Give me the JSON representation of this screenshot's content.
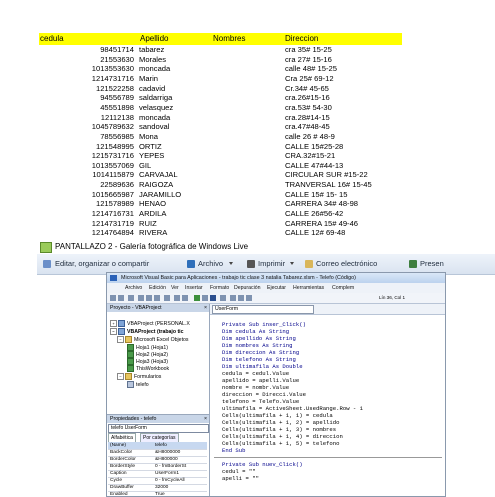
{
  "spreadsheet": {
    "headers": {
      "cedula": "cedula",
      "apellido": "Apellido",
      "nombres": "Nombres",
      "direccion": "Direccion"
    },
    "rows": [
      {
        "cedula": "98451714",
        "apellido": "tabarez",
        "direccion": "cra 35# 15-25"
      },
      {
        "cedula": "21553630",
        "apellido": "Morales",
        "direccion": "cra 27# 15-16"
      },
      {
        "cedula": "1013553630",
        "apellido": "moncada",
        "direccion": "calle 48# 15-25"
      },
      {
        "cedula": "1214731716",
        "apellido": "Marin",
        "direccion": "Cra 25# 69-12"
      },
      {
        "cedula": "121522258",
        "apellido": "cadavid",
        "direccion": "Cr.34# 45-65"
      },
      {
        "cedula": "94556789",
        "apellido": "saldarriga",
        "direccion": "cra.26#15-16"
      },
      {
        "cedula": "45551898",
        "apellido": "velasquez",
        "direccion": "cra.53# 54-30"
      },
      {
        "cedula": "12112138",
        "apellido": "moncada",
        "direccion": "cra.28#14-15"
      },
      {
        "cedula": "1045789632",
        "apellido": "sandoval",
        "direccion": "cra.47#48-45"
      },
      {
        "cedula": "78556985",
        "apellido": "Mona",
        "direccion": "calle 26 # 48-9"
      },
      {
        "cedula": "121548995",
        "apellido": "ORTIZ",
        "direccion": "CALLE 15#25-28"
      },
      {
        "cedula": "1215731716",
        "apellido": "YEPES",
        "direccion": "CRA.32#15-21"
      },
      {
        "cedula": "1013557069",
        "apellido": "GIL",
        "direccion": "CALLE 47#44-13"
      },
      {
        "cedula": "1014115879",
        "apellido": "CARVAJAL",
        "direccion": "CIRCULAR SUR #15-22"
      },
      {
        "cedula": "22589636",
        "apellido": "RAIGOZA",
        "direccion": "TRANVERSAL 16# 15-45"
      },
      {
        "cedula": "1015665987",
        "apellido": "JARAMILLO",
        "direccion": "CALLE 15# 15- 15"
      },
      {
        "cedula": "121578989",
        "apellido": "HENAO",
        "direccion": "CARRERA 34# 48-98"
      },
      {
        "cedula": "1214716731",
        "apellido": "ARDILA",
        "direccion": "CALLE 26#56-42"
      },
      {
        "cedula": "1214731719",
        "apellido": "RUIZ",
        "direccion": "CARRERA 15# 49-46"
      },
      {
        "cedula": "1214764894",
        "apellido": "RIVERA",
        "direccion": "CALLE 12# 69-48"
      }
    ]
  },
  "gallery": {
    "title": "PANTALLAZO 2 - Galería fotográfica de Windows Live",
    "toolbar": {
      "edit_share": "Editar, organizar o compartir",
      "file": "Archivo",
      "print": "Imprimir",
      "email": "Correo electrónico",
      "present": "Presen"
    }
  },
  "vbe": {
    "title": "Microsoft Visual Basic para Aplicaciones - trabajo tic clase 3 natalia Tabarez.xlsm - Telefo (Código)",
    "menu": [
      "Archivo",
      "Edición",
      "Ver",
      "Insertar",
      "Formato",
      "Depuración",
      "Ejecutar",
      "Herramientas",
      "Complem"
    ],
    "position": "Lín 36, Col 1",
    "project": {
      "header": "Proyecto - VBAProject",
      "nodes": [
        {
          "label": "VBAProject (PERSONAL.X"
        },
        {
          "label": "VBAProject (trabajo tic"
        },
        {
          "label": "Microsoft Excel Objetos"
        },
        {
          "label": "Hoja1 (Hoja1)"
        },
        {
          "label": "Hoja2 (Hoja2)"
        },
        {
          "label": "Hoja3 (Hoja3)"
        },
        {
          "label": "ThisWorkbook"
        },
        {
          "label": "Formularios"
        },
        {
          "label": "telefo"
        }
      ]
    },
    "properties": {
      "header": "Propiedades - telefo",
      "object": "telefo UserForm",
      "tab_alpha": "Alfabética",
      "tab_cat": "Por categorías",
      "rows": [
        {
          "name": "(Name)",
          "value": "telefo"
        },
        {
          "name": "BackColor",
          "value": "&H8000000"
        },
        {
          "name": "BorderColor",
          "value": "&H800000"
        },
        {
          "name": "BorderStyle",
          "value": "0 - fmBorderSt"
        },
        {
          "name": "Caption",
          "value": "UserForm1"
        },
        {
          "name": "Cycle",
          "value": "0 - fmCycleAll"
        },
        {
          "name": "DrawBuffer",
          "value": "32000"
        },
        {
          "name": "Enabled",
          "value": "True"
        }
      ]
    },
    "code": {
      "object_combo": "UserForm",
      "lines": [
        "Private Sub inser_Click()",
        "Dim cedula As String",
        "Dim apellido As String",
        "Dim nombres As String",
        "Dim direccion As String",
        "Dim telefono As String",
        "Dim ultimafila As Double",
        "cedula = cedul.Value",
        "apellido = apelli.Value",
        "nombre = nombr.Value",
        "direccion = Direcci.Value",
        "telefono = Telefo.Value",
        "ultimafila = ActiveSheet.UsedRange.Row - 1",
        "Cells(ultimafila + 1, 1) = cedula",
        "Cells(ultimafila + 1, 2) = apellido",
        "Cells(ultimafila + 1, 3) = nombres",
        "Cells(ultimafila + 1, 4) = direccion",
        "Cells(ultimafila + 1, 5) = telefono",
        "End Sub",
        "Private Sub nuev_Click()",
        "cedul = \"\"",
        "apelli = \"\""
      ]
    }
  }
}
